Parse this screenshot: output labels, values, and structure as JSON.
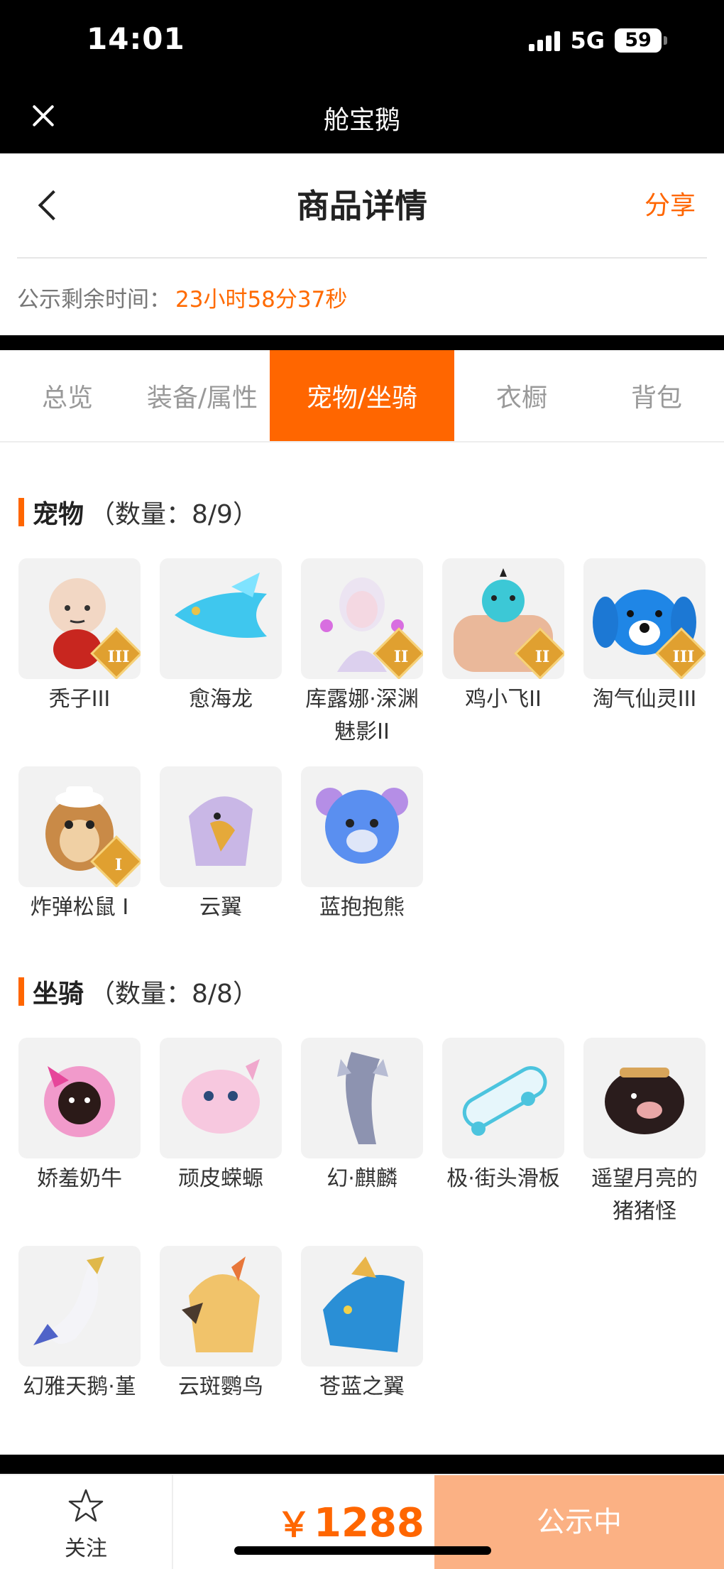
{
  "status_bar": {
    "time": "14:01",
    "network": "5G",
    "battery": "59"
  },
  "app_bar": {
    "title": "舱宝鹅"
  },
  "header": {
    "title": "商品详情",
    "share_label": "分享",
    "countdown_label": "公示剩余时间：",
    "countdown_value": "23小时58分37秒"
  },
  "tabs": [
    {
      "label": "总览"
    },
    {
      "label": "装备/属性"
    },
    {
      "label": "宠物/坐骑",
      "active": true
    },
    {
      "label": "衣橱"
    },
    {
      "label": "背包"
    }
  ],
  "pets_section": {
    "title": "宠物",
    "count": "（数量：8/9）",
    "items": [
      {
        "name": "秃子III",
        "rank": "III",
        "icon": "bald-chibi-pet"
      },
      {
        "name": "愈海龙",
        "rank": "",
        "icon": "sea-dragon-pet"
      },
      {
        "name": "库露娜·深渊魅影II",
        "rank": "II",
        "icon": "kuluna-pet"
      },
      {
        "name": "鸡小飞II",
        "rank": "II",
        "icon": "chick-pet"
      },
      {
        "name": "淘气仙灵III",
        "rank": "III",
        "icon": "fairy-pet"
      },
      {
        "name": "炸弹松鼠 I",
        "rank": "I",
        "icon": "bomb-squirrel-pet"
      },
      {
        "name": "云翼",
        "rank": "",
        "icon": "cloud-wing-pet"
      },
      {
        "name": "蓝抱抱熊",
        "rank": "",
        "icon": "blue-bear-pet"
      }
    ]
  },
  "mounts_section": {
    "title": "坐骑",
    "count": "（数量：8/8）",
    "items": [
      {
        "name": "娇羞奶牛",
        "icon": "shy-cow-mount"
      },
      {
        "name": "顽皮蝾螈",
        "icon": "axolotl-mount"
      },
      {
        "name": "幻·麒麟",
        "icon": "qilin-mount"
      },
      {
        "name": "极·街头滑板",
        "icon": "skateboard-mount"
      },
      {
        "name": "遥望月亮的猪猪怪",
        "icon": "moon-pig-mount"
      },
      {
        "name": "幻雅天鹅·堇",
        "icon": "swan-mount"
      },
      {
        "name": "云斑鹦鸟",
        "icon": "parrot-mount"
      },
      {
        "name": "苍蓝之翼",
        "icon": "azure-wing-mount"
      }
    ]
  },
  "bottom_bar": {
    "follow_label": "关注",
    "currency": "￥",
    "price": "1288",
    "status_label": "公示中"
  },
  "colors": {
    "accent": "#ff6600",
    "status_button": "#fbb184"
  }
}
